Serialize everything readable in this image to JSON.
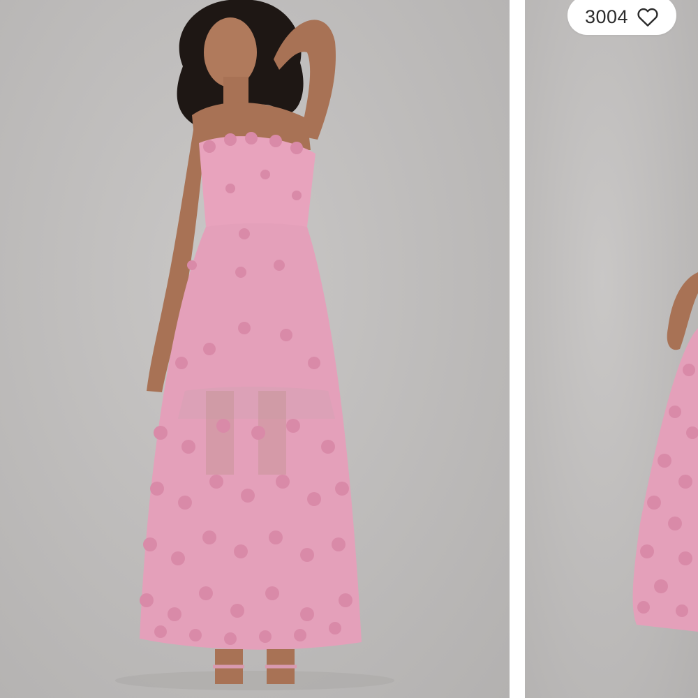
{
  "gallery": {
    "slides": [
      {
        "subject": "model-pink-floral-strapless-dress-front"
      },
      {
        "subject": "model-pink-floral-strapless-dress-side"
      }
    ]
  },
  "like": {
    "count": "3004",
    "icon": "heart-outline-icon"
  },
  "colors": {
    "background": "#bebcbb",
    "dress": "#e8a3bd",
    "petals": "#d98aa8",
    "divider": "#ffffff",
    "text": "#2a2a2a"
  }
}
